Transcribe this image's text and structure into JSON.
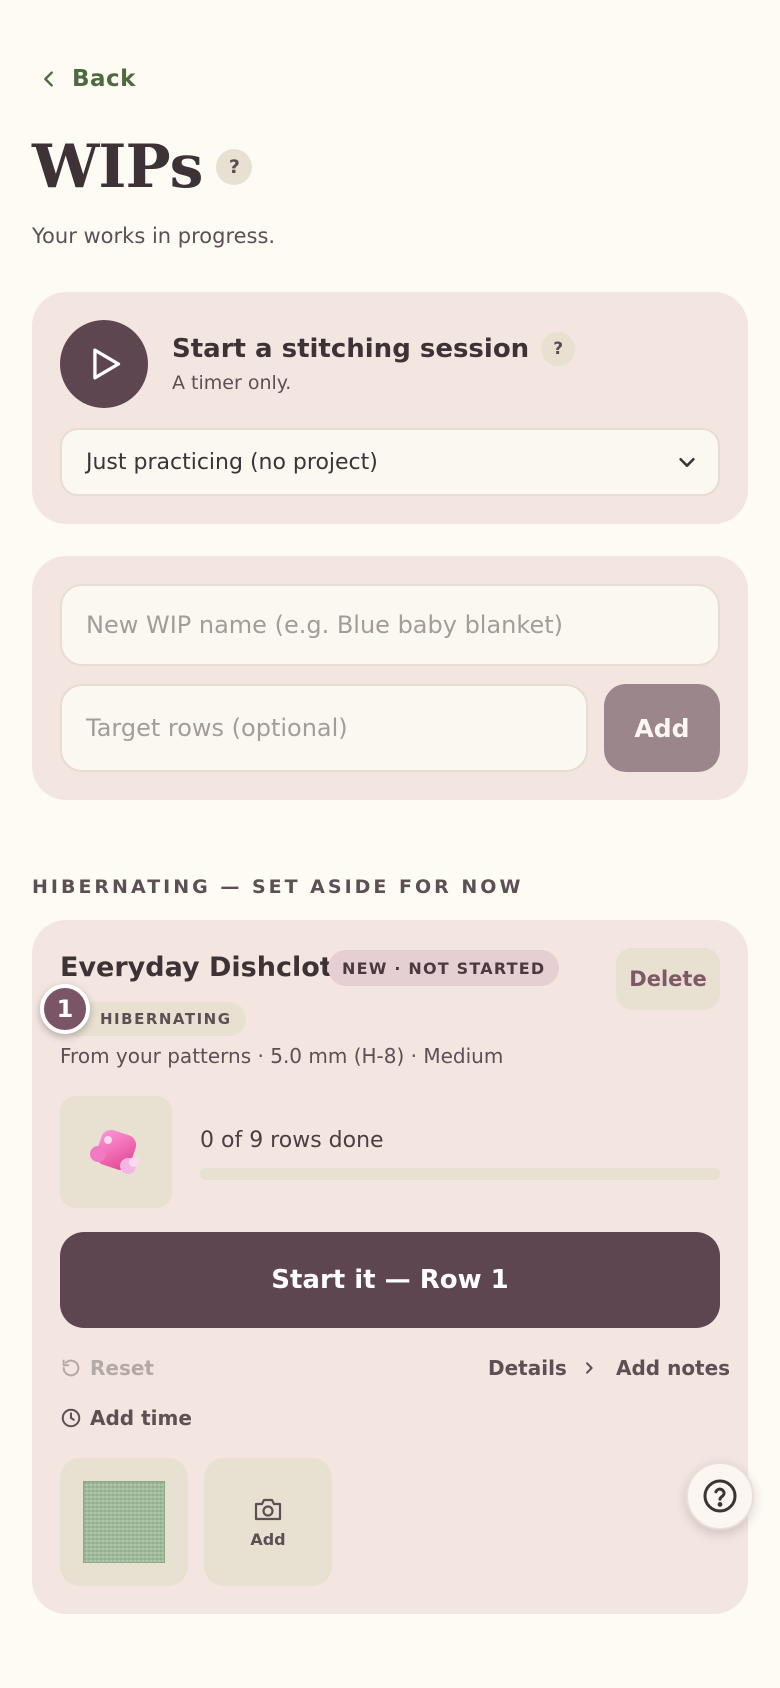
{
  "nav": {
    "back_label": "Back"
  },
  "header": {
    "title": "WIPs",
    "help_badge": "?",
    "subtitle": "Your works in progress."
  },
  "session": {
    "title": "Start a stitching session",
    "help_badge": "?",
    "subtitle": "A timer only.",
    "project_select": "Just practicing (no project)"
  },
  "new_wip": {
    "name_placeholder": "New WIP name (e.g. Blue baby blanket)",
    "rows_placeholder": "Target rows (optional)",
    "add_label": "Add"
  },
  "section": {
    "label": "HIBERNATING — SET ASIDE FOR NOW"
  },
  "wip": {
    "name": "Everyday Dishcloth",
    "status_badge": "NEW · NOT STARTED",
    "state_badge": "HIBERNATING",
    "marker": "1",
    "delete_label": "Delete",
    "meta": "From your patterns · 5.0 mm (H-8) · Medium",
    "progress_text": "0 of 9 rows done",
    "progress_fraction": 0,
    "start_label": "Start it — Row 1",
    "reset_label": "Reset",
    "details_label": "Details",
    "notes_label": "Add notes",
    "add_time_label": "Add time",
    "add_photo_label": "Add"
  },
  "colors": {
    "accent": "#5e4650",
    "link_green": "#4d6b3f",
    "card_bg": "#f3e5df",
    "page_bg": "#fdfbf4"
  }
}
